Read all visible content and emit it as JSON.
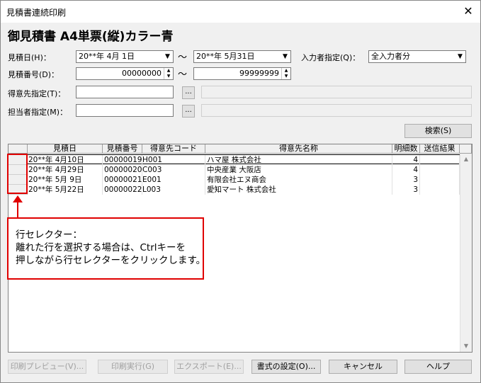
{
  "window": {
    "title": "見積書連続印刷",
    "close_label": "✕"
  },
  "heading": "御見積書 A4単票(縦)カラー青",
  "form": {
    "estimate_date_label": "見積日(H)：",
    "date_from": "20**年 4月 1日",
    "date_to": "20**年 5月31日",
    "tilde": "～",
    "input_person_label": "入力者指定(Q)：",
    "input_person_value": "全入力者分",
    "estimate_no_label": "見積番号(D)：",
    "no_from": "00000000",
    "no_to": "99999999",
    "customer_label": "得意先指定(T)：",
    "staff_label": "担当者指定(M)：",
    "browse_label": "...",
    "search_label": "検索(S)"
  },
  "grid": {
    "columns": [
      "見積日",
      "見積番号",
      "得意先コード",
      "得意先名称",
      "明細数",
      "送信結果"
    ],
    "rows": [
      {
        "date": "20**年 4月10日",
        "no": "00000019",
        "code": "H001",
        "name": "ハマ屋 株式会社",
        "details": "4",
        "result": ""
      },
      {
        "date": "20**年 4月29日",
        "no": "00000020",
        "code": "C003",
        "name": "中央産業 大阪店",
        "details": "4",
        "result": ""
      },
      {
        "date": "20**年 5月 9日",
        "no": "00000021",
        "code": "E001",
        "name": "有限会社エヌ商会",
        "details": "3",
        "result": ""
      },
      {
        "date": "20**年 5月22日",
        "no": "00000022",
        "code": "L003",
        "name": "愛知マート 株式会社",
        "details": "3",
        "result": ""
      }
    ]
  },
  "callout": {
    "line1": "行セレクター：",
    "line2": "離れた行を選択する場合は、Ctrlキーを",
    "line3": "押しながら行セレクターをクリックします。"
  },
  "footer": {
    "preview": "印刷プレビュー(V)...",
    "print": "印刷実行(G)",
    "export": "エクスポート(E)...",
    "format": "書式の設定(O)...",
    "cancel": "キャンセル",
    "help": "ヘルプ"
  },
  "colors": {
    "accent_red": "#e00000"
  }
}
